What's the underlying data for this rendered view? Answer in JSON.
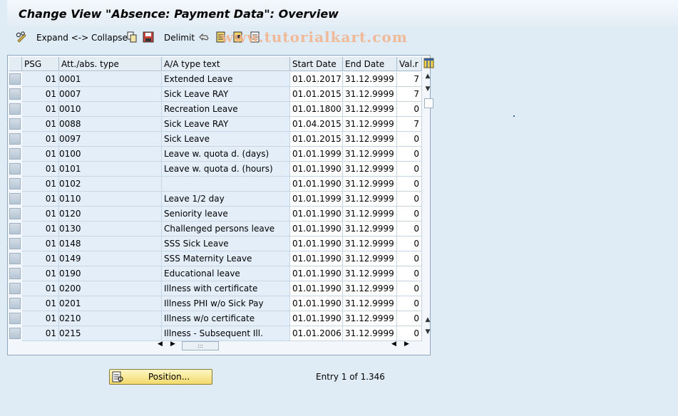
{
  "window": {
    "title": "Change View \"Absence: Payment Data\": Overview"
  },
  "toolbar": {
    "expand_collapse_label": "Expand <-> Collapse",
    "delimit_label": "Delimit",
    "icons": [
      "glasses-pencil-icon",
      "copy-icon",
      "save-local-icon",
      "undo-icon",
      "select-all-icon",
      "select-block-icon",
      "deselect-all-icon"
    ]
  },
  "watermark": "www.tutorialkart.com",
  "table": {
    "headers": [
      "PSG",
      "Att./abs. type",
      "A/A type text",
      "Start Date",
      "End Date",
      "Val.r"
    ],
    "rows": [
      {
        "psg": "01",
        "type": "0001",
        "text": "Extended Leave",
        "start": "01.01.2017",
        "end": "31.12.9999",
        "val": "7"
      },
      {
        "psg": "01",
        "type": "0007",
        "text": "Sick Leave RAY",
        "start": "01.01.2015",
        "end": "31.12.9999",
        "val": "7"
      },
      {
        "psg": "01",
        "type": "0010",
        "text": "Recreation Leave",
        "start": "01.01.1800",
        "end": "31.12.9999",
        "val": "0"
      },
      {
        "psg": "01",
        "type": "0088",
        "text": "Sick Leave RAY",
        "start": "01.04.2015",
        "end": "31.12.9999",
        "val": "7"
      },
      {
        "psg": "01",
        "type": "0097",
        "text": "Sick Leave",
        "start": "01.01.2015",
        "end": "31.12.9999",
        "val": "0"
      },
      {
        "psg": "01",
        "type": "0100",
        "text": "Leave w. quota d. (days)",
        "start": "01.01.1999",
        "end": "31.12.9999",
        "val": "0"
      },
      {
        "psg": "01",
        "type": "0101",
        "text": "Leave w. quota d. (hours)",
        "start": "01.01.1990",
        "end": "31.12.9999",
        "val": "0"
      },
      {
        "psg": "01",
        "type": "0102",
        "text": "",
        "start": "01.01.1990",
        "end": "31.12.9999",
        "val": "0"
      },
      {
        "psg": "01",
        "type": "0110",
        "text": "Leave 1/2 day",
        "start": "01.01.1999",
        "end": "31.12.9999",
        "val": "0"
      },
      {
        "psg": "01",
        "type": "0120",
        "text": "Seniority leave",
        "start": "01.01.1990",
        "end": "31.12.9999",
        "val": "0"
      },
      {
        "psg": "01",
        "type": "0130",
        "text": "Challenged persons leave",
        "start": "01.01.1990",
        "end": "31.12.9999",
        "val": "0"
      },
      {
        "psg": "01",
        "type": "0148",
        "text": "SSS Sick Leave",
        "start": "01.01.1990",
        "end": "31.12.9999",
        "val": "0"
      },
      {
        "psg": "01",
        "type": "0149",
        "text": "SSS Maternity Leave",
        "start": "01.01.1990",
        "end": "31.12.9999",
        "val": "0"
      },
      {
        "psg": "01",
        "type": "0190",
        "text": "Educational leave",
        "start": "01.01.1990",
        "end": "31.12.9999",
        "val": "0"
      },
      {
        "psg": "01",
        "type": "0200",
        "text": "Illness with certificate",
        "start": "01.01.1990",
        "end": "31.12.9999",
        "val": "0"
      },
      {
        "psg": "01",
        "type": "0201",
        "text": "Illness PHI w/o Sick Pay",
        "start": "01.01.1990",
        "end": "31.12.9999",
        "val": "0"
      },
      {
        "psg": "01",
        "type": "0210",
        "text": "Illness w/o certificate",
        "start": "01.01.1990",
        "end": "31.12.9999",
        "val": "0"
      },
      {
        "psg": "01",
        "type": "0215",
        "text": "Illness - Subsequent Ill.",
        "start": "01.01.2006",
        "end": "31.12.9999",
        "val": "0"
      }
    ]
  },
  "footer": {
    "position_button_label": "Position...",
    "entry_text": "Entry 1 of 1.346"
  },
  "colors": {
    "background": "#dfebf5",
    "button_yellow": "#f2da6c",
    "watermark": "#f3b28a"
  }
}
